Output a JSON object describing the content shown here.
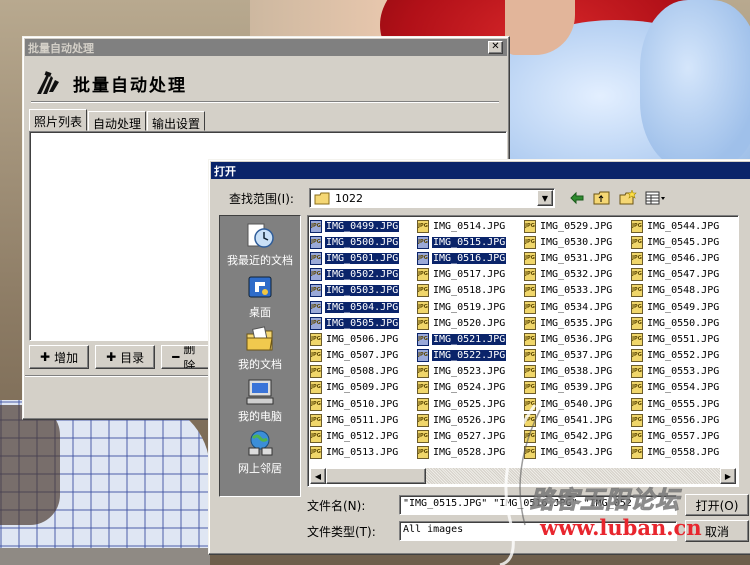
{
  "batch_window": {
    "title": "批量自动处理",
    "close_label": "✕",
    "header_title": "批量自动处理",
    "tabs": [
      {
        "label": "照片列表",
        "selected": true
      },
      {
        "label": "自动处理",
        "selected": false
      },
      {
        "label": "输出设置",
        "selected": false
      }
    ],
    "buttons": [
      {
        "icon": "plus-icon",
        "label": "增加"
      },
      {
        "icon": "plus-icon",
        "label": "目录"
      },
      {
        "icon": "minus-icon",
        "label": "删除"
      }
    ]
  },
  "open_dialog": {
    "title": "打开",
    "look_in_label": "查找范围(I):",
    "look_in_value": "1022",
    "places": [
      {
        "icon": "recent-docs-icon",
        "label": "我最近的文档"
      },
      {
        "icon": "desktop-icon",
        "label": "桌面"
      },
      {
        "icon": "my-documents-icon",
        "label": "我的文档"
      },
      {
        "icon": "my-computer-icon",
        "label": "我的电脑"
      },
      {
        "icon": "network-icon",
        "label": "网上邻居"
      }
    ],
    "file_icon_label": "JPG",
    "columns": [
      [
        {
          "name": "IMG_0499.JPG",
          "selected": true
        },
        {
          "name": "IMG_0500.JPG",
          "selected": true
        },
        {
          "name": "IMG_0501.JPG",
          "selected": true
        },
        {
          "name": "IMG_0502.JPG",
          "selected": true
        },
        {
          "name": "IMG_0503.JPG",
          "selected": true
        },
        {
          "name": "IMG_0504.JPG",
          "selected": true
        },
        {
          "name": "IMG_0505.JPG",
          "selected": true
        },
        {
          "name": "IMG_0506.JPG",
          "selected": false
        },
        {
          "name": "IMG_0507.JPG",
          "selected": false
        },
        {
          "name": "IMG_0508.JPG",
          "selected": false
        },
        {
          "name": "IMG_0509.JPG",
          "selected": false
        },
        {
          "name": "IMG_0510.JPG",
          "selected": false
        },
        {
          "name": "IMG_0511.JPG",
          "selected": false
        },
        {
          "name": "IMG_0512.JPG",
          "selected": false
        },
        {
          "name": "IMG_0513.JPG",
          "selected": false
        }
      ],
      [
        {
          "name": "IMG_0514.JPG",
          "selected": false
        },
        {
          "name": "IMG_0515.JPG",
          "selected": true
        },
        {
          "name": "IMG_0516.JPG",
          "selected": true
        },
        {
          "name": "IMG_0517.JPG",
          "selected": false
        },
        {
          "name": "IMG_0518.JPG",
          "selected": false
        },
        {
          "name": "IMG_0519.JPG",
          "selected": false
        },
        {
          "name": "IMG_0520.JPG",
          "selected": false
        },
        {
          "name": "IMG_0521.JPG",
          "selected": true
        },
        {
          "name": "IMG_0522.JPG",
          "selected": true
        },
        {
          "name": "IMG_0523.JPG",
          "selected": false
        },
        {
          "name": "IMG_0524.JPG",
          "selected": false
        },
        {
          "name": "IMG_0525.JPG",
          "selected": false
        },
        {
          "name": "IMG_0526.JPG",
          "selected": false
        },
        {
          "name": "IMG_0527.JPG",
          "selected": false
        },
        {
          "name": "IMG_0528.JPG",
          "selected": false
        }
      ],
      [
        {
          "name": "IMG_0529.JPG",
          "selected": false
        },
        {
          "name": "IMG_0530.JPG",
          "selected": false
        },
        {
          "name": "IMG_0531.JPG",
          "selected": false
        },
        {
          "name": "IMG_0532.JPG",
          "selected": false
        },
        {
          "name": "IMG_0533.JPG",
          "selected": false
        },
        {
          "name": "IMG_0534.JPG",
          "selected": false
        },
        {
          "name": "IMG_0535.JPG",
          "selected": false
        },
        {
          "name": "IMG_0536.JPG",
          "selected": false
        },
        {
          "name": "IMG_0537.JPG",
          "selected": false
        },
        {
          "name": "IMG_0538.JPG",
          "selected": false
        },
        {
          "name": "IMG_0539.JPG",
          "selected": false
        },
        {
          "name": "IMG_0540.JPG",
          "selected": false
        },
        {
          "name": "IMG_0541.JPG",
          "selected": false
        },
        {
          "name": "IMG_0542.JPG",
          "selected": false
        },
        {
          "name": "IMG_0543.JPG",
          "selected": false
        }
      ],
      [
        {
          "name": "IMG_0544.JPG",
          "selected": false
        },
        {
          "name": "IMG_0545.JPG",
          "selected": false
        },
        {
          "name": "IMG_0546.JPG",
          "selected": false
        },
        {
          "name": "IMG_0547.JPG",
          "selected": false
        },
        {
          "name": "IMG_0548.JPG",
          "selected": false
        },
        {
          "name": "IMG_0549.JPG",
          "selected": false
        },
        {
          "name": "IMG_0550.JPG",
          "selected": false
        },
        {
          "name": "IMG_0551.JPG",
          "selected": false
        },
        {
          "name": "IMG_0552.JPG",
          "selected": false
        },
        {
          "name": "IMG_0553.JPG",
          "selected": false
        },
        {
          "name": "IMG_0554.JPG",
          "selected": false
        },
        {
          "name": "IMG_0555.JPG",
          "selected": false
        },
        {
          "name": "IMG_0556.JPG",
          "selected": false
        },
        {
          "name": "IMG_0557.JPG",
          "selected": false
        },
        {
          "name": "IMG_0558.JPG",
          "selected": false
        }
      ]
    ],
    "filename_label": "文件名(N):",
    "filename_value": "\"IMG_0515.JPG\" \"IMG_0516.JPG\" \"IMG_052",
    "filetype_label": "文件类型(T):",
    "filetype_value": "All images",
    "open_button": "打开(O)",
    "cancel_button": "取消"
  },
  "watermark": {
    "text": "路客玉阳论坛",
    "url": "www.luban.cn"
  },
  "colors": {
    "selection": "#0a246a",
    "window_face": "#d4d0c8",
    "places_bar": "#808080"
  }
}
